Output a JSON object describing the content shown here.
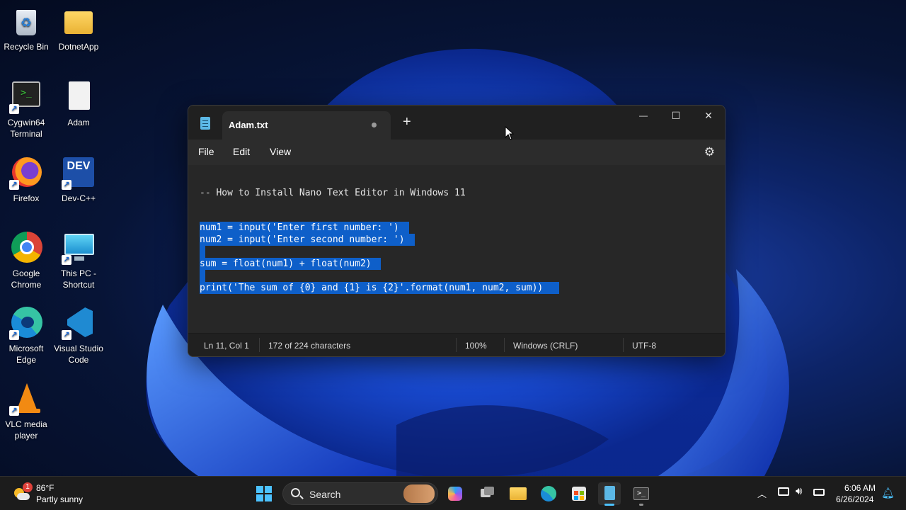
{
  "desktop": {
    "icons": [
      {
        "label": "Recycle Bin"
      },
      {
        "label": "DotnetApp"
      },
      {
        "label": "Cygwin64 Terminal"
      },
      {
        "label": "Adam"
      },
      {
        "label": "Firefox"
      },
      {
        "label": "Dev-C++"
      },
      {
        "label": "Google Chrome"
      },
      {
        "label": "This PC - Shortcut"
      },
      {
        "label": "Microsoft Edge"
      },
      {
        "label": "Visual Studio Code"
      },
      {
        "label": "VLC media player"
      }
    ],
    "dev_badge": "DEV"
  },
  "notepad": {
    "tab_title": "Adam.txt",
    "new_tab_glyph": "+",
    "minimize_glyph": "—",
    "maximize_glyph": "☐",
    "close_glyph": "✕",
    "menu": {
      "file": "File",
      "edit": "Edit",
      "view": "View"
    },
    "lines": [
      "-- How to Install Nano Text Editor in Windows 11",
      "num1 = input('Enter first number: ') ",
      "num2 = input('Enter second number: ') ",
      "sum = float(num1) + float(num2) ",
      "print('The sum of {0} and {1} is {2}'.format(num1, num2, sum)) "
    ],
    "status": {
      "position": "Ln 11, Col 1",
      "characters": "172 of 224 characters",
      "zoom": "100%",
      "line_ending": "Windows (CRLF)",
      "encoding": "UTF-8"
    },
    "colors": {
      "selection": "#0e5fc9",
      "background": "#272727"
    }
  },
  "taskbar": {
    "weather": {
      "temp": "86°F",
      "condition": "Partly sunny",
      "badge": "1"
    },
    "search_label": "Search",
    "clock": {
      "time": "6:06 AM",
      "date": "6/26/2024"
    }
  }
}
